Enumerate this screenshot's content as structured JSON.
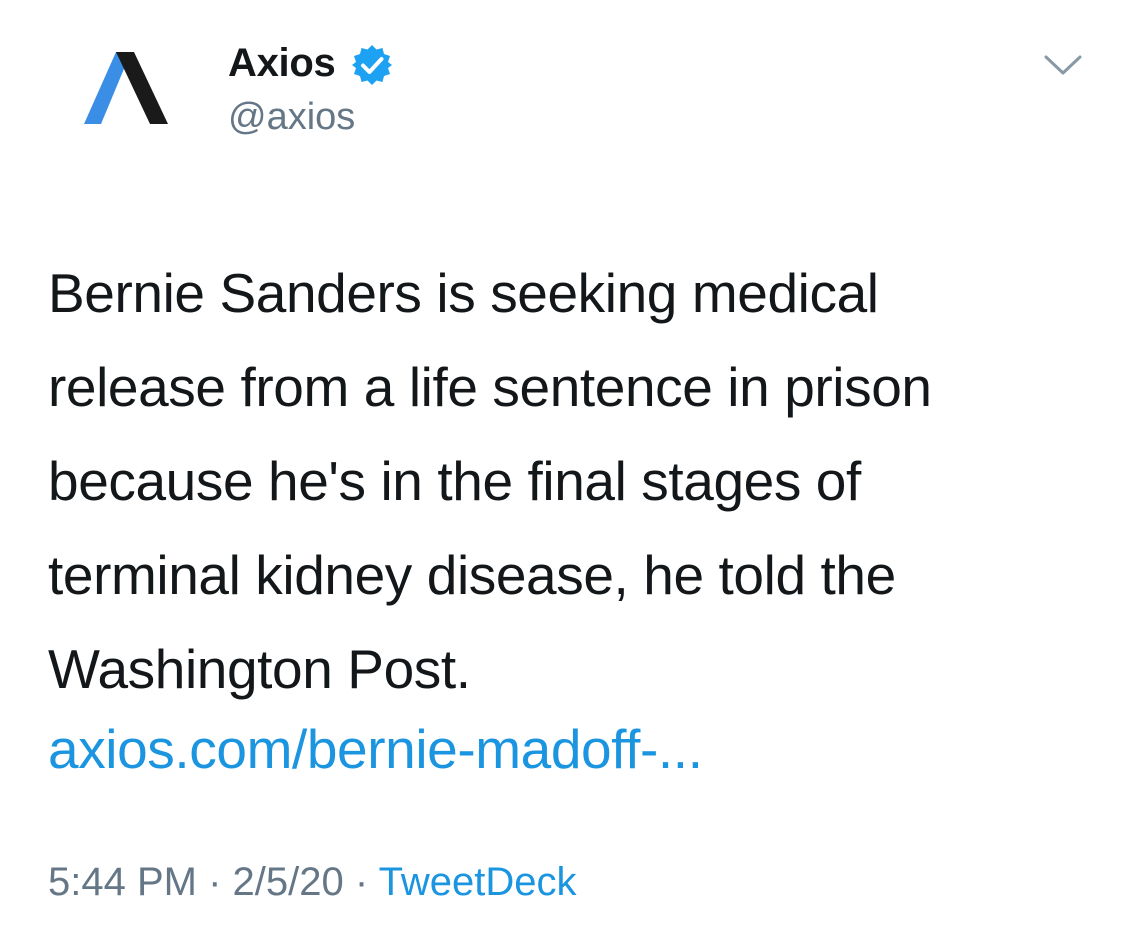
{
  "account": {
    "display_name": "Axios",
    "handle": "@axios",
    "verified": true,
    "avatar_icon": "axios-logo-icon"
  },
  "tweet": {
    "text_lines": [
      "Bernie Sanders is seeking medical",
      "release from a life sentence in prison",
      "because he's in the final stages of",
      "terminal kidney disease, he told the",
      "Washington Post."
    ],
    "link_text": "axios.com/bernie-madoff-..."
  },
  "meta": {
    "time": "5:44 PM",
    "separator": "·",
    "date": "2/5/20",
    "source": "TweetDeck"
  },
  "colors": {
    "text": "#14171a",
    "secondary": "#657786",
    "link": "#1b95e0",
    "verified": "#1da1f2",
    "logo_blue": "#3a8ee6",
    "logo_black": "#1a1a1a"
  },
  "icons": {
    "options": "chevron-down-icon",
    "verified": "verified-badge-icon"
  }
}
